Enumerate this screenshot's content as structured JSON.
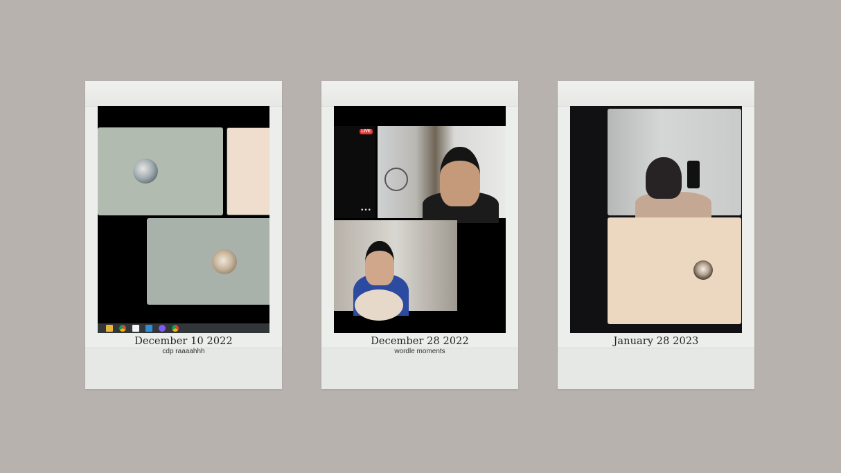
{
  "polaroids": [
    {
      "date": "December 10 2022",
      "note": "cdp raaaahhh",
      "taskbar_icons": [
        "file-explorer-icon",
        "chrome-icon",
        "notion-icon",
        "vscode-icon",
        "app-icon",
        "chrome-icon"
      ]
    },
    {
      "date": "December 28 2022",
      "note": "wordle moments",
      "live_badge": "LIVE",
      "more_menu": "•••"
    },
    {
      "date": "January 28 2023",
      "note": ""
    }
  ],
  "colors": {
    "background": "#b7b2ad",
    "frame": "#eceeeb",
    "live": "#e53935"
  }
}
